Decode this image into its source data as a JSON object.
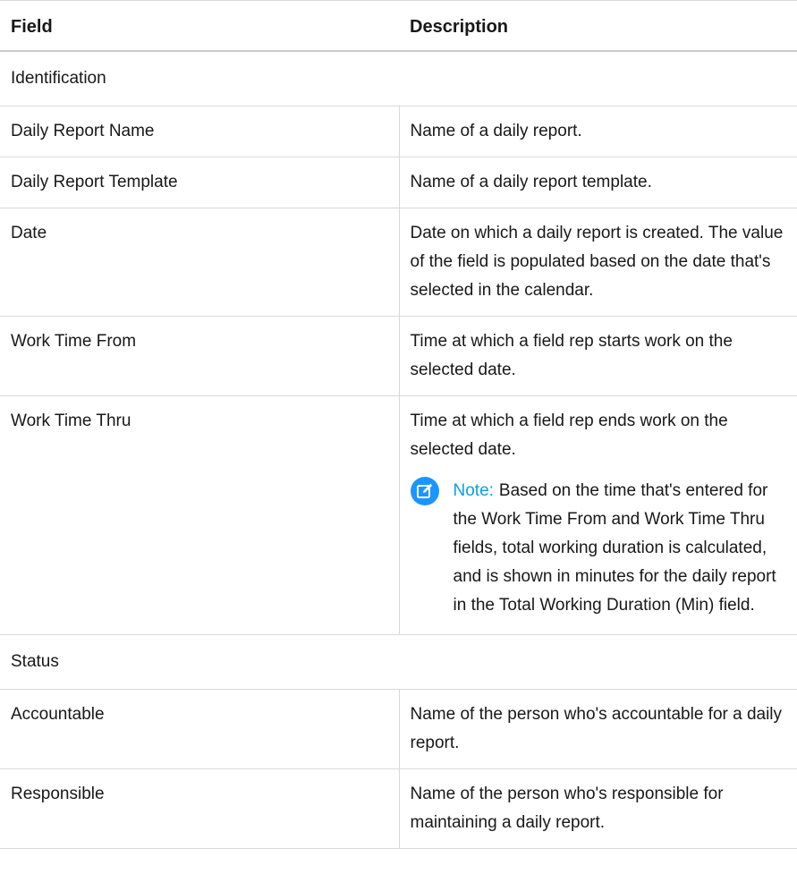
{
  "table": {
    "headers": {
      "field": "Field",
      "description": "Description"
    },
    "sections": [
      {
        "title": "Identification",
        "rows": [
          {
            "field": "Daily Report Name",
            "description": "Name of a daily report."
          },
          {
            "field": "Daily Report Template",
            "description": "Name of a daily report template."
          },
          {
            "field": "Date",
            "description": "Date on which a daily report is created. The value of the field is populated based on the date that's selected in the calendar."
          },
          {
            "field": "Work Time From",
            "description": "Time at which a field rep starts work on the selected date."
          },
          {
            "field": "Work Time Thru",
            "description": "Time at which a field rep ends work on the selected date.",
            "note": {
              "label": "Note:",
              "text": "Based on the time that's entered for the Work Time From and Work Time Thru fields, total working duration is calculated, and is shown in minutes for the daily report in the Total Working Duration (Min) field.",
              "icon": "edit-note-icon",
              "accent_color": "#1b96ff"
            }
          }
        ]
      },
      {
        "title": "Status",
        "rows": [
          {
            "field": "Accountable",
            "description": "Name of the person who's accountable for a daily report."
          },
          {
            "field": "Responsible",
            "description": "Name of the person who's responsible for maintaining a daily report."
          }
        ]
      }
    ]
  }
}
